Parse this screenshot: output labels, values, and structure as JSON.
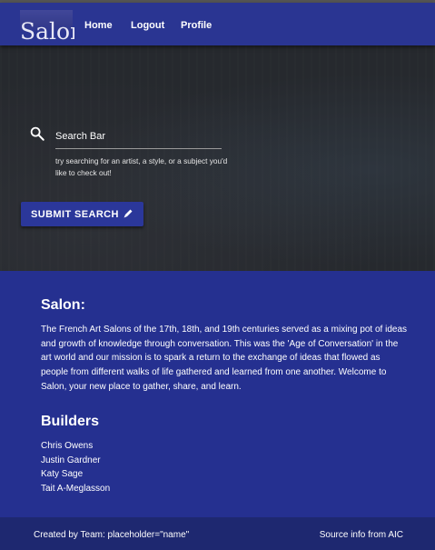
{
  "navbar": {
    "logo_text": "Salon",
    "links": [
      "Home",
      "Logout",
      "Profile"
    ]
  },
  "search": {
    "placeholder": "Search Bar",
    "helper_text": "try searching for an artist, a style, or a subject you'd like to check out!",
    "submit_label": "SUBMIT SEARCH"
  },
  "about": {
    "title": "Salon:",
    "text": "The French Art Salons of the 17th, 18th, and 19th centuries served as a mixing pot of ideas and growth of knowledge through conversation. This was the 'Age of Conversation' in the art world and our mission is to spark a return to the exchange of ideas that flowed as people from different walks of life gathered and learned from one another. Welcome to Salon, your new place to gather, share, and learn."
  },
  "builders": {
    "title": "Builders",
    "names": [
      "Chris Owens",
      "Justin Gardner",
      "Katy Sage",
      "Tait A-Meglasson"
    ]
  },
  "footer": {
    "left": "Created by Team: placeholder=\"name\"",
    "right": "Source info from AIC"
  },
  "colors": {
    "primary": "#253090",
    "navbar": "#2a3592",
    "hero_bg": "#26292e",
    "footer": "#1e2870"
  },
  "icons": {
    "search": "search-icon",
    "submit": "pencil-icon"
  }
}
